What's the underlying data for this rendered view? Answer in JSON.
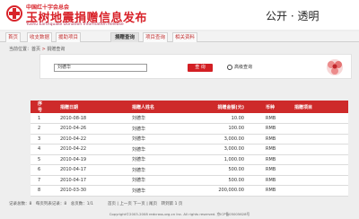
{
  "header": {
    "org_name": "中国红十字会总会",
    "site_title": "玉树地震捐赠信息发布",
    "site_subtitle": "Yushu Earthquake Donation Information Release",
    "slogan": "公开 · 透明"
  },
  "nav": {
    "items": [
      {
        "label": "首页",
        "active": false
      },
      {
        "label": "收支数据",
        "active": false
      },
      {
        "label": "援助项目",
        "active": false
      },
      {
        "label": "捐赠查询",
        "active": true
      },
      {
        "label": "项目查询",
        "active": false
      },
      {
        "label": "相关资料",
        "active": false
      }
    ]
  },
  "breadcrumb": {
    "prefix": "当前位置：",
    "home": "首页",
    "separator": " > ",
    "current": "捐赠查询"
  },
  "search": {
    "query": "刘德华",
    "button_label": "查 询",
    "advanced_label": "高级查询"
  },
  "table": {
    "headers": [
      "序号",
      "捐赠日期",
      "捐赠人姓名",
      "捐赠金额(元)",
      "币种",
      "捐赠项目"
    ],
    "rows": [
      {
        "seq": "1",
        "date": "2010-08-18",
        "name": "刘德华",
        "amount": "10.00",
        "currency": "RMB",
        "project": ""
      },
      {
        "seq": "2",
        "date": "2010-04-26",
        "name": "刘德华",
        "amount": "100.00",
        "currency": "RMB",
        "project": ""
      },
      {
        "seq": "3",
        "date": "2010-04-22",
        "name": "刘德华",
        "amount": "3,000.00",
        "currency": "RMB",
        "project": ""
      },
      {
        "seq": "4",
        "date": "2010-04-22",
        "name": "刘德华",
        "amount": "3,000.00",
        "currency": "RMB",
        "project": ""
      },
      {
        "seq": "5",
        "date": "2010-04-19",
        "name": "刘德华",
        "amount": "1,000.00",
        "currency": "RMB",
        "project": ""
      },
      {
        "seq": "6",
        "date": "2010-04-17",
        "name": "刘德华",
        "amount": "500.00",
        "currency": "RMB",
        "project": ""
      },
      {
        "seq": "7",
        "date": "2010-04-17",
        "name": "刘德华",
        "amount": "500.00",
        "currency": "RMB",
        "project": ""
      },
      {
        "seq": "8",
        "date": "2010-03-30",
        "name": "刘德华",
        "amount": "200,000.00",
        "currency": "RMB",
        "project": ""
      }
    ]
  },
  "pager": {
    "summary": "记录总数：8　每页列表记录：8　总页数：1/1",
    "controls": "首页 | 上一页 下一页 | 尾页　转到第 1 页"
  },
  "footer": {
    "copyright": "Copyright©2003-2008 redcross.org.cn Inc. All rights reserved. 京ICP备05005628号"
  },
  "colors": {
    "brand_red": "#d8232a",
    "table_header": "#ce2a2a"
  }
}
